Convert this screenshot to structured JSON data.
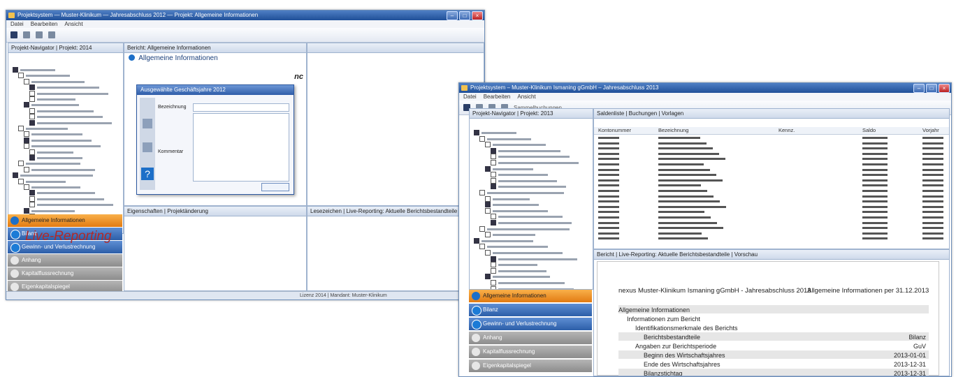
{
  "caption": "Live-Reporting",
  "left_window": {
    "navigator_tabs": "Projekt-Navigator | Projekt: 2014",
    "report_tab": "Bericht: Allgemeine Informationen",
    "report_heading": "Allgemeine Informationen",
    "nav_panel": {
      "items": [
        {
          "label": "Allgemeine Informationen",
          "state": "active"
        },
        {
          "label": "Bilanz",
          "state": "blue"
        },
        {
          "label": "Gewinn- und Verlustrechnung",
          "state": "blue"
        },
        {
          "label": "Anhang",
          "state": "grey"
        },
        {
          "label": "Kapitalflussrechnung",
          "state": "grey"
        },
        {
          "label": "Eigenkapitalspiegel",
          "state": "grey"
        }
      ]
    },
    "dialog": {
      "title": "Ausgewählte Geschäftsjahre 2012",
      "field1_label": "Bezeichnung",
      "field2_label": "Kommentar",
      "help_label": "?"
    },
    "bottom_tabs": "Eigenschaften | Projektänderung",
    "right_bottom_tab": "Lesezeichen | Live-Reporting: Aktuelle Berichtsbestandteile",
    "status": "Lizenz 2014 | Mandant: Muster-Klinikum"
  },
  "right_window": {
    "title": "Projektsystem – Muster-Klinikum Ismaning gGmbH – Jahresabschluss 2013",
    "menu": [
      "Datei",
      "Bearbeiten",
      "Ansicht"
    ],
    "toolbar_label": "Sammelbuchungen",
    "navigator_tab": "Projekt-Navigator | Projekt: 2013",
    "saldenliste_tab": "Saldenliste | Buchungen | Vorlagen",
    "table_headers": [
      "Kontonummer",
      "Bezeichnung",
      "Kennz.",
      "Saldo",
      "Vorjahr"
    ],
    "report_tab": "Bericht | Live-Reporting: Aktuelle Berichtsbestandteile | Vorschau",
    "report": {
      "title": "nexus Muster-Klinikum Ismaning gGmbH - Jahresabschluss 2013",
      "subtitle": "Allgemeine Informationen per 31.12.2013",
      "lines": [
        {
          "text": "Allgemeine Informationen",
          "indent": 0,
          "shade": true
        },
        {
          "text": "Informationen zum Bericht",
          "indent": 1,
          "shade": false
        },
        {
          "text": "Identifikationsmerkmale des Berichts",
          "indent": 2,
          "shade": false
        },
        {
          "text": "Berichtsbestandteile",
          "indent": 3,
          "shade": true
        },
        {
          "text": "Angaben zur Berichtsperiode",
          "indent": 2,
          "shade": false
        },
        {
          "text": "Beginn des Wirtschaftsjahres",
          "indent": 3,
          "shade": true
        },
        {
          "text": "Ende des Wirtschaftsjahres",
          "indent": 3,
          "shade": false
        },
        {
          "text": "Bilanzstichtag",
          "indent": 3,
          "shade": true
        }
      ],
      "values": [
        "Bilanz",
        "GuV",
        "2013-01-01",
        "2013-12-31",
        "2013-12-31"
      ]
    },
    "nav_panel": {
      "items": [
        {
          "label": "Allgemeine Informationen",
          "state": "active"
        },
        {
          "label": "Bilanz",
          "state": "blue"
        },
        {
          "label": "Gewinn- und Verlustrechnung",
          "state": "blue"
        },
        {
          "label": "Anhang",
          "state": "grey"
        },
        {
          "label": "Kapitalflussrechnung",
          "state": "grey"
        },
        {
          "label": "Eigenkapitalspiegel",
          "state": "grey"
        }
      ]
    }
  }
}
